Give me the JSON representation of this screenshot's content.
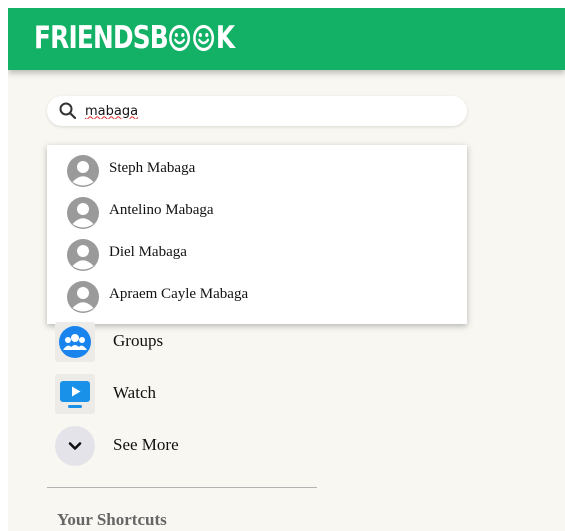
{
  "app": {
    "logo_text_left": "FRIENDSB",
    "logo_text_right": "K"
  },
  "search": {
    "value": "mabaga"
  },
  "search_results": [
    {
      "name": "Steph Mabaga"
    },
    {
      "name": "Antelino Mabaga"
    },
    {
      "name": "Diel Mabaga"
    },
    {
      "name": "Apraem Cayle Mabaga"
    }
  ],
  "sidebar": {
    "items": [
      {
        "label": "Groups",
        "icon": "groups-icon"
      },
      {
        "label": "Watch",
        "icon": "watch-icon"
      },
      {
        "label": "See More",
        "icon": "chevron-down-icon"
      }
    ],
    "shortcuts_title": "Your Shortcuts"
  },
  "colors": {
    "brand": "#12b165",
    "background": "#f8f7f1",
    "groups_icon": "#1a84ee",
    "watch_icon": "#1991e8"
  }
}
